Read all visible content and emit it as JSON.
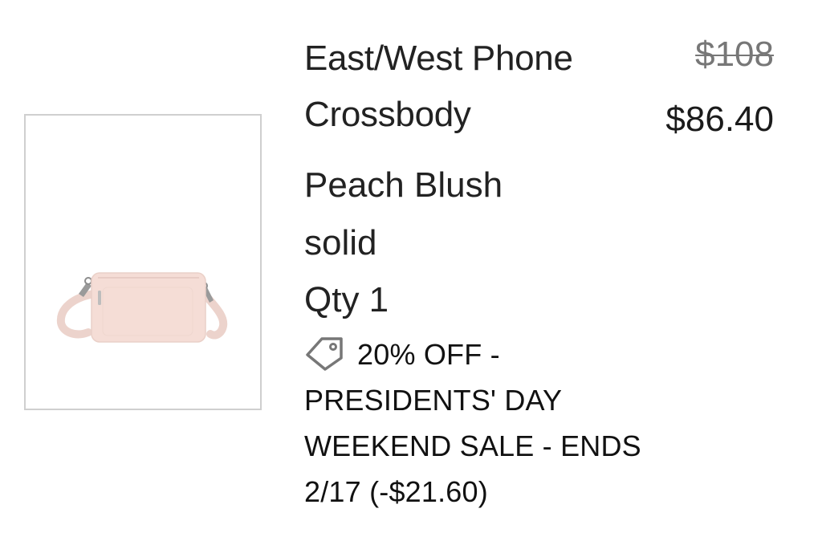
{
  "product": {
    "name": "East/West Phone Crossbody",
    "price_original": "$108",
    "price_sale": "$86.40",
    "color": "Peach Blush",
    "pattern": "solid",
    "quantity": "Qty 1",
    "image_icon": "crossbody-bag-thumbnail"
  },
  "promotion": {
    "icon": "price-tag-icon",
    "text": "20% OFF - PRESIDENTS' DAY WEEKEND SALE - ENDS 2/17 (-$21.60)"
  },
  "colors": {
    "bag": "#f5ddd6",
    "border": "#cfcfcf",
    "strikethrough_text": "#777777"
  }
}
